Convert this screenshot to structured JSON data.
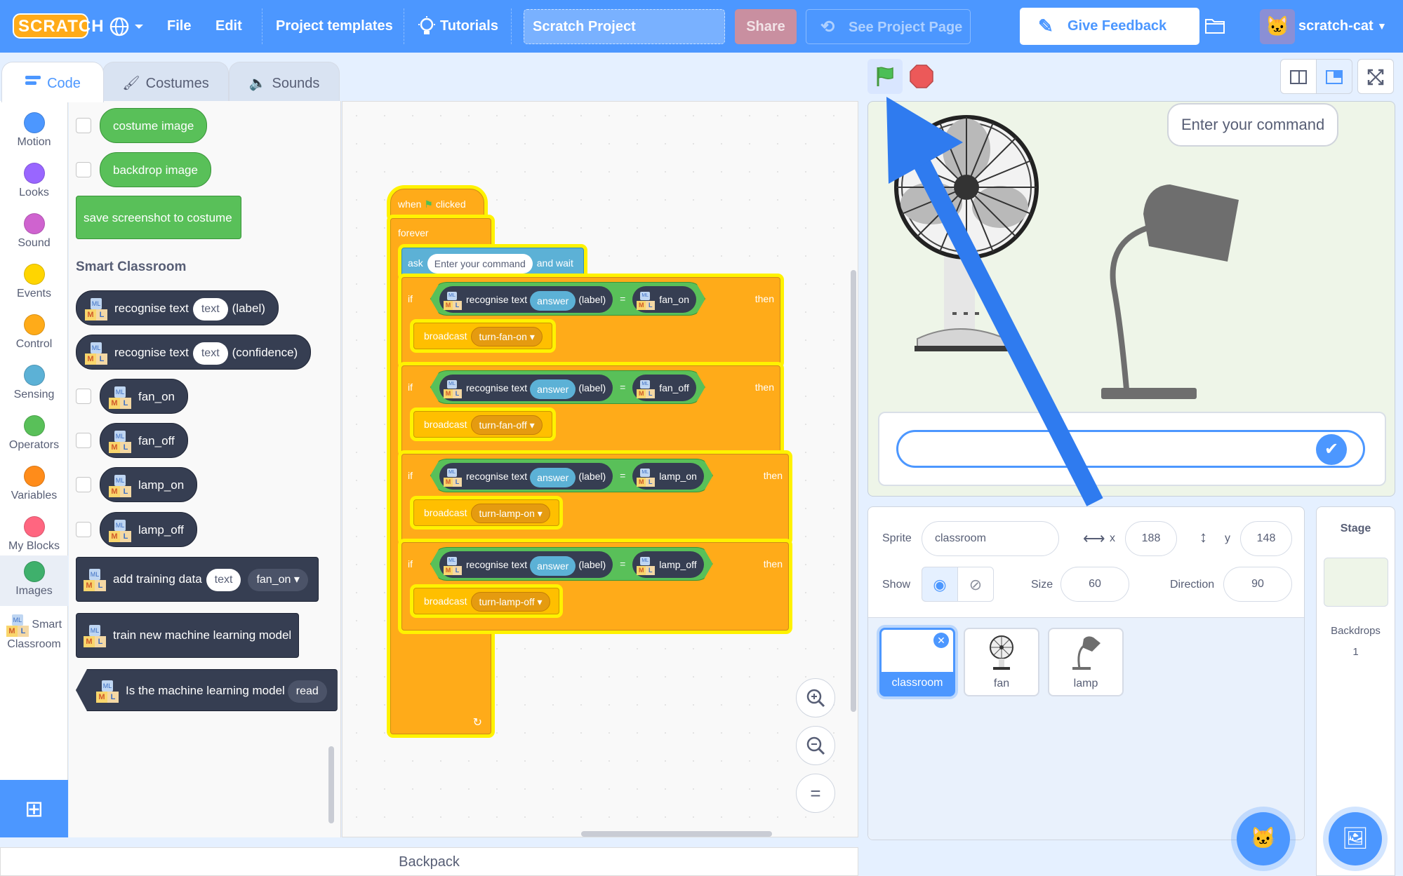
{
  "menubar": {
    "logo_text": "SCRATCH",
    "file": "File",
    "edit": "Edit",
    "project_templates": "Project templates",
    "tutorials": "Tutorials",
    "project_title": "Scratch Project",
    "share": "Share",
    "see_project_page": "See Project Page",
    "give_feedback": "Give Feedback",
    "username": "scratch-cat",
    "accent_color": "#4c97ff"
  },
  "tabs": {
    "code": "Code",
    "costumes": "Costumes",
    "sounds": "Sounds"
  },
  "categories": [
    {
      "label": "Motion",
      "color": "#4c97ff"
    },
    {
      "label": "Looks",
      "color": "#9966ff"
    },
    {
      "label": "Sound",
      "color": "#cf63cf"
    },
    {
      "label": "Events",
      "color": "#ffd500"
    },
    {
      "label": "Control",
      "color": "#ffab19"
    },
    {
      "label": "Sensing",
      "color": "#5cb1d6"
    },
    {
      "label": "Operators",
      "color": "#59c059"
    },
    {
      "label": "Variables",
      "color": "#ff8c1a"
    },
    {
      "label": "My Blocks",
      "color": "#ff6680"
    },
    {
      "label": "Images",
      "color": "#3fb06c"
    },
    {
      "label": "Smart Classroom",
      "color": ""
    }
  ],
  "palette": {
    "costume_image": "costume image",
    "backdrop_image": "backdrop image",
    "save_screenshot": "save screenshot to costume",
    "section_title": "Smart Classroom",
    "recognise_text": "recognise text",
    "text_arg": "text",
    "label_suffix": "(label)",
    "confidence_suffix": "(confidence)",
    "fan_on": "fan_on",
    "fan_off": "fan_off",
    "lamp_on": "lamp_on",
    "lamp_off": "lamp_off",
    "add_training_data": "add training data",
    "train_model": "train new machine learning model",
    "is_model": "Is the machine learning model",
    "ready_pill": "read"
  },
  "script": {
    "when": "when",
    "clicked": "clicked",
    "forever": "forever",
    "ask": "ask",
    "ask_text": "Enter your command",
    "and_wait": "and wait",
    "if": "if",
    "then": "then",
    "recognise_text": "recognise text",
    "answer": "answer",
    "label": "(label)",
    "equals": "=",
    "broadcast": "broadcast",
    "conditions": [
      "fan_on",
      "fan_off",
      "lamp_on",
      "lamp_off"
    ],
    "broadcasts": [
      "turn-fan-on",
      "turn-fan-off",
      "turn-lamp-on",
      "turn-lamp-off"
    ]
  },
  "zoom": {
    "in": "+",
    "out": "−",
    "reset": "="
  },
  "backpack": "Backpack",
  "stage": {
    "speech": "Enter your command"
  },
  "sprite_info": {
    "sprite_label": "Sprite",
    "sprite_name": "classroom",
    "x_label": "x",
    "x_value": "188",
    "y_label": "y",
    "y_value": "148",
    "show_label": "Show",
    "size_label": "Size",
    "size_value": "60",
    "direction_label": "Direction",
    "direction_value": "90"
  },
  "sprites": [
    "classroom",
    "fan",
    "lamp"
  ],
  "stage_pane": {
    "title": "Stage",
    "backdrops_label": "Backdrops",
    "backdrops_count": "1"
  }
}
